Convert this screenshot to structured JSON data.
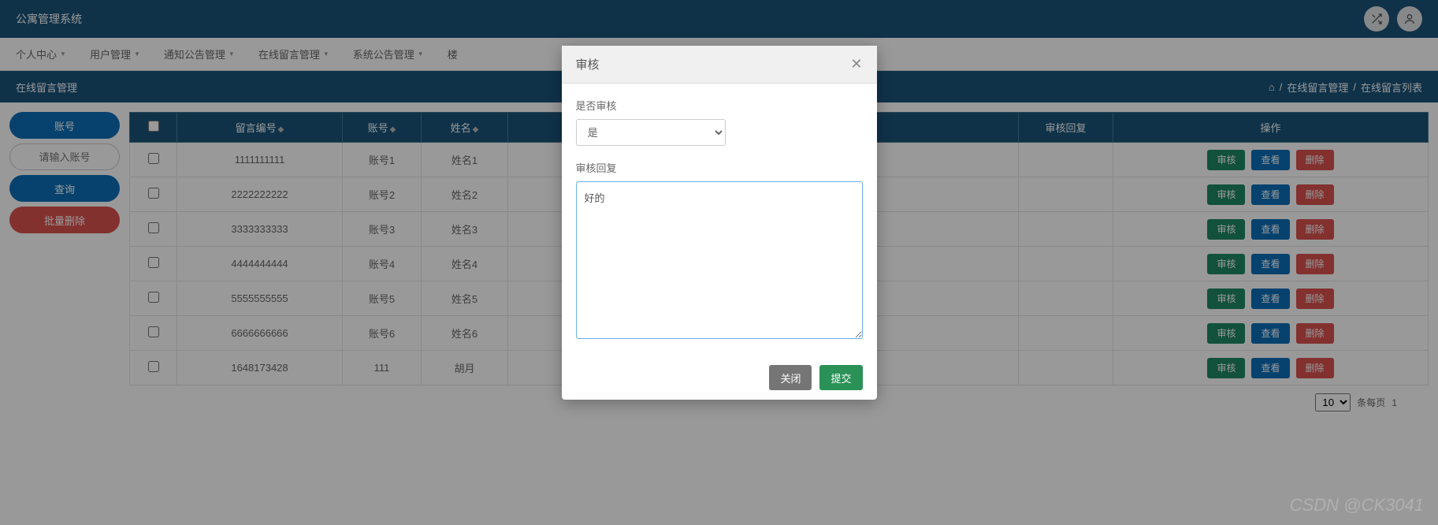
{
  "header": {
    "title": "公寓管理系统"
  },
  "nav": {
    "items": [
      {
        "label": "个人中心"
      },
      {
        "label": "用户管理"
      },
      {
        "label": "通知公告管理"
      },
      {
        "label": "在线留言管理"
      },
      {
        "label": "系统公告管理"
      },
      {
        "label": "楼"
      }
    ]
  },
  "breadcrumb": {
    "title": "在线留言管理",
    "path1": "在线留言管理",
    "path2": "在线留言列表"
  },
  "sidebar": {
    "account_label": "账号",
    "account_placeholder": "请输入账号",
    "search_label": "查询",
    "batch_delete_label": "批量删除"
  },
  "table": {
    "headers": {
      "id": "留言编号",
      "account": "账号",
      "name": "姓名",
      "reply": "审核回复",
      "ops": "操作"
    },
    "rows": [
      {
        "id": "1111111111",
        "account": "账号1",
        "name": "姓名1"
      },
      {
        "id": "2222222222",
        "account": "账号2",
        "name": "姓名2"
      },
      {
        "id": "3333333333",
        "account": "账号3",
        "name": "姓名3"
      },
      {
        "id": "4444444444",
        "account": "账号4",
        "name": "姓名4"
      },
      {
        "id": "5555555555",
        "account": "账号5",
        "name": "姓名5"
      },
      {
        "id": "6666666666",
        "account": "账号6",
        "name": "姓名6"
      },
      {
        "id": "1648173428",
        "account": "111",
        "name": "胡月"
      }
    ],
    "ops": {
      "audit": "审核",
      "view": "查看",
      "delete": "删除"
    }
  },
  "pager": {
    "pagesize": "10",
    "per_page": "条每页",
    "page": "1"
  },
  "modal": {
    "title": "审核",
    "label_audit": "是否审核",
    "select_value": "是",
    "label_reply": "审核回复",
    "textarea_value": "好的",
    "close_label": "关闭",
    "submit_label": "提交"
  },
  "watermark": "CSDN @CK3041"
}
